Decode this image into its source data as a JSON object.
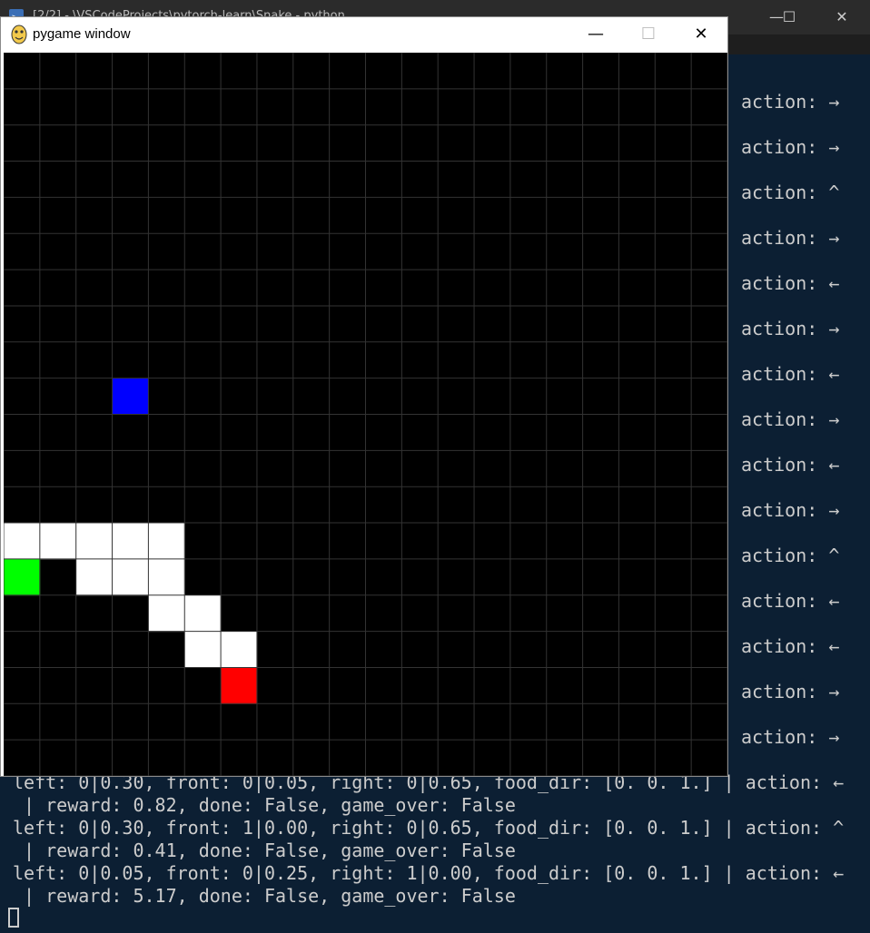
{
  "terminal": {
    "title": "[2/2] - \\VSCodeProjects\\pytorch-learn\\Snake - python",
    "controls": {
      "minimize": "—",
      "maximize": "☐",
      "close": "✕"
    },
    "right_actions": [
      "action: →",
      "action: →",
      "action: ^",
      "action: →",
      "action: ←",
      "action: →",
      "action: ←",
      "action: →",
      "action: ←",
      "action: →",
      "action: ^",
      "action: ←",
      "action: ←",
      "action: →",
      "action: →"
    ],
    "bottom_lines": [
      "left: 0|0.30, front: 0|0.05, right: 0|0.65, food_dir: [0. 0. 1.] | action: ←",
      " | reward: 0.82, done: False, game_over: False",
      "left: 0|0.30, front: 1|0.00, right: 0|0.65, food_dir: [0. 0. 1.] | action: ^",
      " | reward: 0.41, done: False, game_over: False",
      "left: 0|0.05, front: 0|0.25, right: 1|0.00, food_dir: [0. 0. 1.] | action: ←",
      " | reward: 5.17, done: False, game_over: False"
    ]
  },
  "pygame_window": {
    "title": "pygame window",
    "controls": {
      "minimize": "—",
      "maximize": "☐",
      "close": "✕"
    }
  },
  "game": {
    "grid_cols": 20,
    "grid_rows": 20,
    "colors": {
      "background": "#000000",
      "grid": "#333333",
      "snake": "#ffffff",
      "head": "#ff0000",
      "food": "#00ff00",
      "obstacle": "#0000ff"
    },
    "obstacle": [
      3,
      9
    ],
    "food": [
      0,
      14
    ],
    "head": [
      6,
      17
    ],
    "snake_body": [
      [
        0,
        13
      ],
      [
        1,
        13
      ],
      [
        2,
        13
      ],
      [
        3,
        13
      ],
      [
        4,
        13
      ],
      [
        2,
        14
      ],
      [
        3,
        14
      ],
      [
        4,
        14
      ],
      [
        4,
        15
      ],
      [
        5,
        15
      ],
      [
        5,
        16
      ],
      [
        6,
        16
      ]
    ]
  }
}
